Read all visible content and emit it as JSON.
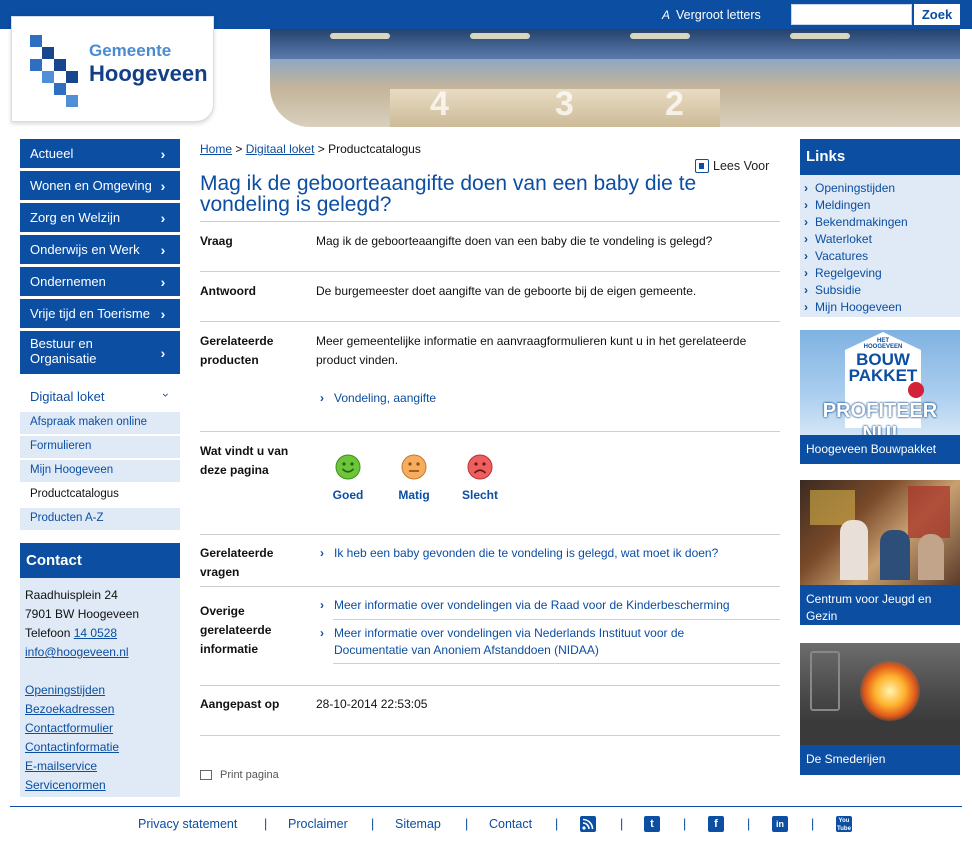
{
  "topbar": {
    "enlarge_icon": "A",
    "enlarge_label": "Vergroot letters",
    "search_placeholder": "",
    "search_button": "Zoek"
  },
  "header": {
    "logo_line1": "Gemeente",
    "logo_line2": "Hoogeveen",
    "hero_numbers": [
      "4",
      "3",
      "2"
    ]
  },
  "leftnav": {
    "items": [
      {
        "label": "Actueel"
      },
      {
        "label": "Wonen en Omgeving"
      },
      {
        "label": "Zorg en Welzijn"
      },
      {
        "label": "Onderwijs en Werk"
      },
      {
        "label": "Ondernemen"
      },
      {
        "label": "Vrije tijd en Toerisme"
      },
      {
        "label": "Bestuur en Organisatie"
      }
    ],
    "active": "Digitaal loket",
    "subitems": [
      "Afspraak maken online",
      "Formulieren",
      "Mijn Hoogeveen",
      "Productcatalogus",
      "Producten A-Z"
    ]
  },
  "contact": {
    "title": "Contact",
    "address1": "Raadhuisplein 24",
    "address2": "7901 BW Hoogeveen",
    "phone_label": "Telefoon",
    "phone": "14 0528",
    "email": "info@hoogeveen.nl",
    "links": [
      "Openingstijden",
      "Bezoekadressen",
      "Contactformulier",
      "Contactinformatie",
      "E-mailservice",
      "Servicenormen"
    ]
  },
  "main": {
    "breadcrumb": {
      "home": "Home",
      "sep": ">",
      "level2": "Digitaal loket",
      "current": "Productcatalogus"
    },
    "lees_voor": "Lees Voor",
    "title": "Mag ik de geboorteaangifte doen van een baby die te vondeling is gelegd?",
    "vraag_label": "Vraag",
    "vraag_text": "Mag ik de geboorteaangifte doen van een baby die te vondeling is gelegd?",
    "antwoord_label": "Antwoord",
    "antwoord_text": "De burgemeester doet aangifte van de geboorte bij de eigen gemeente.",
    "producten_label": "Gerelateerde producten",
    "producten_text": "Meer gemeentelijke informatie en aanvraagformulieren kunt u in het gerelateerde product vinden.",
    "producten_link": "Vondeling, aangifte",
    "rating_label": "Wat vindt u van deze pagina",
    "rating": [
      {
        "label": "Goed",
        "color": "#5cb82a"
      },
      {
        "label": "Matig",
        "color": "#f2a24a"
      },
      {
        "label": "Slecht",
        "color": "#e24d4d"
      }
    ],
    "vragen_label": "Gerelateerde vragen",
    "vragen_link": "Ik heb een baby gevonden die te vondeling is gelegd, wat moet ik doen?",
    "overige_label": "Overige gerelateerde informatie",
    "overige_links": [
      "Meer informatie over vondelingen via de Raad voor de Kinderbescherming",
      "Meer informatie over vondelingen via Nederlands Instituut voor de Documentatie van Anoniem Afstanddoen (NIDAA)"
    ],
    "aangepast_label": "Aangepast op",
    "aangepast_value": "28-10-2014 22:53:05",
    "print": "Print pagina"
  },
  "right": {
    "links_title": "Links",
    "links": [
      "Openingstijden",
      "Meldingen",
      "Bekendmakingen",
      "Waterloket",
      "Vacatures",
      "Regelgeving",
      "Subsidie",
      "Mijn Hoogeveen"
    ],
    "promo1_img_top": "HET HOOGEVEEN",
    "promo1_img_main": "BOUW PAKKET",
    "promo1_img_slogan": "PROFITEER NU!",
    "promo1_caption": "Hoogeveen Bouwpakket",
    "promo2_caption": "Centrum voor Jeugd en Gezin",
    "promo3_caption": "De Smederijen"
  },
  "footer": {
    "links": [
      "Privacy statement",
      "Proclaimer",
      "Sitemap",
      "Contact"
    ],
    "sep": "|",
    "icons": [
      "rss-icon",
      "twitter-icon",
      "facebook-icon",
      "linkedin-icon",
      "youtube-icon"
    ]
  },
  "colors": {
    "primary": "#0b4ea2",
    "light_panel": "#dfeaf6"
  }
}
